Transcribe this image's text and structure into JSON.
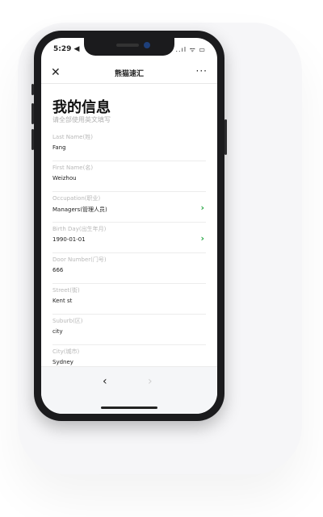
{
  "status": {
    "time": "5:29 ◀",
    "icons": "..ıl ᯤ ▭"
  },
  "navbar": {
    "close": "✕",
    "title": "熊猫速汇",
    "more": "···"
  },
  "header": {
    "title": "我的信息",
    "subtitle": "请全部使用英文填写"
  },
  "fields": [
    {
      "label": "Last Name(姓)",
      "value": "Fang"
    },
    {
      "label": "First Name(名)",
      "value": "Weizhou"
    },
    {
      "label": "Occupation(职业)",
      "value": "Managers(管理人员)",
      "chevron": "›"
    },
    {
      "label": "Birth Day(出生年月)",
      "value": "1990-01-01",
      "chevron": "›"
    },
    {
      "label": "Door Number(门号)",
      "value": "666"
    },
    {
      "label": "Street(街)",
      "value": "Kent st"
    },
    {
      "label": "Suburb(区)",
      "value": "city"
    },
    {
      "label": "City(城市)",
      "value": "Sydney"
    }
  ],
  "footer": {
    "prev": "‹",
    "next": "›"
  }
}
